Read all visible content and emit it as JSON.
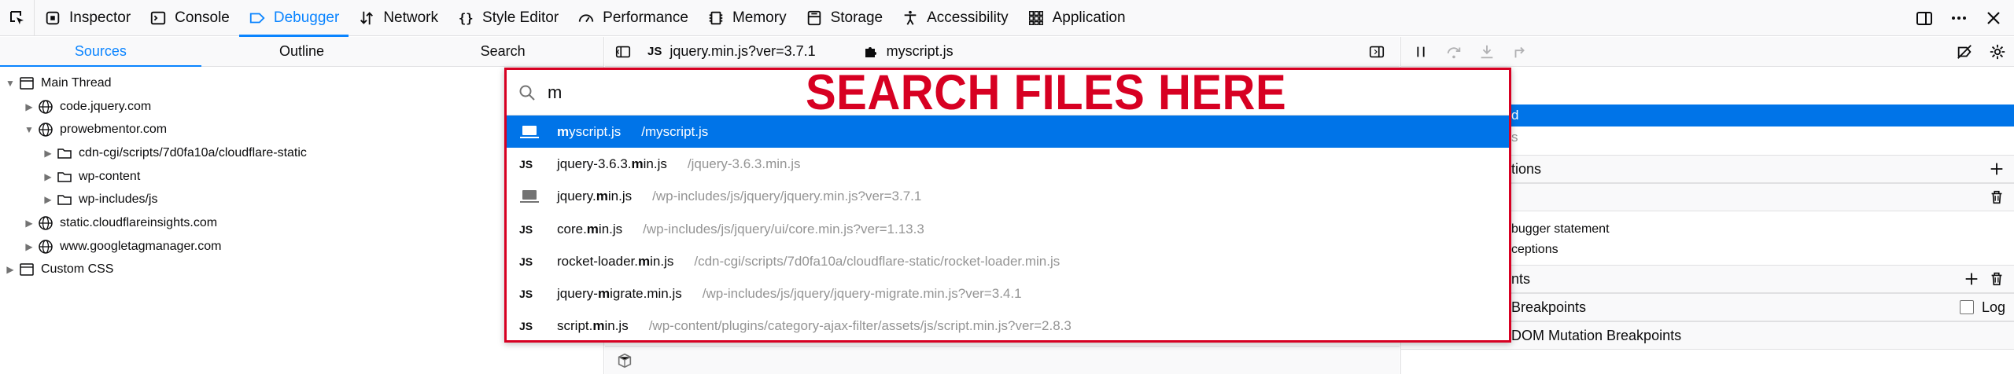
{
  "toolbar": {
    "tabs": [
      {
        "label": "Inspector",
        "icon": "inspector-icon"
      },
      {
        "label": "Console",
        "icon": "console-icon"
      },
      {
        "label": "Debugger",
        "icon": "debugger-icon",
        "active": true
      },
      {
        "label": "Network",
        "icon": "network-icon"
      },
      {
        "label": "Style Editor",
        "icon": "style-editor-icon"
      },
      {
        "label": "Performance",
        "icon": "performance-icon"
      },
      {
        "label": "Memory",
        "icon": "memory-icon"
      },
      {
        "label": "Storage",
        "icon": "storage-icon"
      },
      {
        "label": "Accessibility",
        "icon": "accessibility-icon"
      },
      {
        "label": "Application",
        "icon": "application-icon"
      }
    ],
    "right_icons": [
      "dock-icon",
      "more-icon",
      "close-icon"
    ]
  },
  "left_panel": {
    "tabs": [
      "Sources",
      "Outline",
      "Search"
    ],
    "active_tab": "Sources",
    "tree": [
      {
        "label": "Main Thread",
        "icon": "window-icon",
        "level": 0,
        "expanded": true
      },
      {
        "label": "code.jquery.com",
        "icon": "globe-icon",
        "level": 1,
        "expanded": false
      },
      {
        "label": "prowebmentor.com",
        "icon": "globe-icon",
        "level": 1,
        "expanded": true
      },
      {
        "label": "cdn-cgi/scripts/7d0fa10a/cloudflare-static",
        "icon": "folder-icon",
        "level": 2,
        "expanded": false
      },
      {
        "label": "wp-content",
        "icon": "folder-icon",
        "level": 2,
        "expanded": false
      },
      {
        "label": "wp-includes/js",
        "icon": "folder-icon",
        "level": 2,
        "expanded": false
      },
      {
        "label": "static.cloudflareinsights.com",
        "icon": "globe-icon",
        "level": 1,
        "expanded": false
      },
      {
        "label": "www.googletagmanager.com",
        "icon": "globe-icon",
        "level": 1,
        "expanded": false
      },
      {
        "label": "Custom CSS",
        "icon": "window-icon",
        "level": 0,
        "expanded": false
      }
    ]
  },
  "editor": {
    "tabs": [
      {
        "label": "jquery.min.js?ver=3.7.1",
        "icon": "JS"
      },
      {
        "label": "myscript.js",
        "icon": "puzzle"
      }
    ]
  },
  "right_panel": {
    "rows": [
      {
        "text": "d",
        "selected": true
      },
      {
        "text": "s"
      },
      {
        "text": "tions",
        "header": true,
        "action": "+"
      },
      {
        "text": "",
        "header": true,
        "action": "trash"
      },
      {
        "text": "bugger statement"
      },
      {
        "text": "ceptions"
      },
      {
        "text": "nts",
        "header": true,
        "action": "+trash"
      },
      {
        "text": "Breakpoints",
        "header": true,
        "checkbox_label": "Log"
      },
      {
        "text": "DOM Mutation Breakpoints",
        "header": true
      }
    ]
  },
  "quick_open": {
    "query": "m",
    "annotation": "SEARCH FILES HERE",
    "results": [
      {
        "type": "laptop",
        "pre": "",
        "match": "m",
        "post": "yscript.js",
        "path": "/myscript.js",
        "selected": true
      },
      {
        "type": "JS",
        "pre": "jquery-3.6.3.",
        "match": "m",
        "post": "in.js",
        "path": "/jquery-3.6.3.min.js"
      },
      {
        "type": "laptop",
        "pre": "jquery.",
        "match": "m",
        "post": "in.js",
        "path": "/wp-includes/js/jquery/jquery.min.js?ver=3.7.1"
      },
      {
        "type": "JS",
        "pre": "core.",
        "match": "m",
        "post": "in.js",
        "path": "/wp-includes/js/jquery/ui/core.min.js?ver=1.13.3"
      },
      {
        "type": "JS",
        "pre": "rocket-loader.",
        "match": "m",
        "post": "in.js",
        "path": "/cdn-cgi/scripts/7d0fa10a/cloudflare-static/rocket-loader.min.js"
      },
      {
        "type": "JS",
        "pre": "jquery-",
        "match": "m",
        "post": "igrate.min.js",
        "path": "/wp-includes/js/jquery/jquery-migrate.min.js?ver=3.4.1"
      },
      {
        "type": "JS",
        "pre": "script.",
        "match": "m",
        "post": "in.js",
        "path": "/wp-content/plugins/category-ajax-filter/assets/js/script.min.js?ver=2.8.3"
      }
    ]
  },
  "colors": {
    "accent": "#0a84ff",
    "selected_row": "#0074e8",
    "annotation": "#d70022"
  }
}
